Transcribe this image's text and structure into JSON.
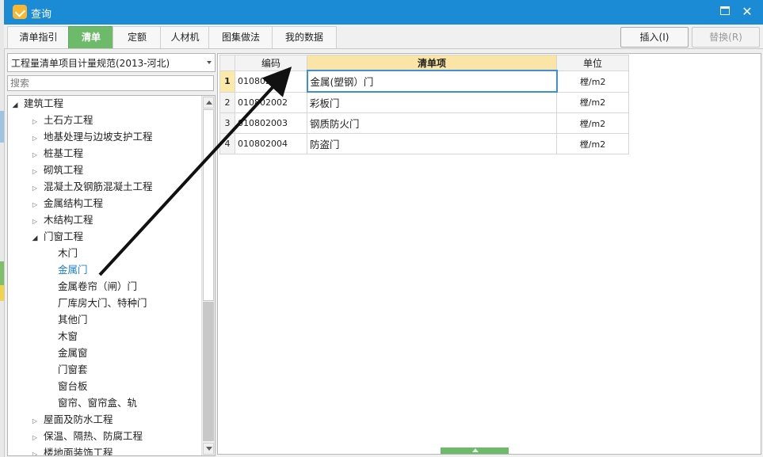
{
  "window": {
    "title": "查询",
    "close_glyph": "✕"
  },
  "tabs": [
    {
      "label": "清单指引",
      "active": false
    },
    {
      "label": "清单",
      "active": true
    },
    {
      "label": "定额",
      "active": false
    },
    {
      "label": "人材机",
      "active": false
    },
    {
      "label": "图集做法",
      "active": false
    },
    {
      "label": "我的数据",
      "active": false
    }
  ],
  "toolbar": {
    "insert_label": "插入(I)",
    "replace_label": "替换(R)"
  },
  "left": {
    "spec_select": "工程量清单项目计量规范(2013-河北)",
    "search_placeholder": "搜索",
    "tree": [
      {
        "label": "建筑工程",
        "level": 0,
        "state": "open"
      },
      {
        "label": "土石方工程",
        "level": 1,
        "state": "closed"
      },
      {
        "label": "地基处理与边坡支护工程",
        "level": 1,
        "state": "closed"
      },
      {
        "label": "桩基工程",
        "level": 1,
        "state": "closed"
      },
      {
        "label": "砌筑工程",
        "level": 1,
        "state": "closed"
      },
      {
        "label": "混凝土及钢筋混凝土工程",
        "level": 1,
        "state": "closed"
      },
      {
        "label": "金属结构工程",
        "level": 1,
        "state": "closed"
      },
      {
        "label": "木结构工程",
        "level": 1,
        "state": "closed"
      },
      {
        "label": "门窗工程",
        "level": 1,
        "state": "open"
      },
      {
        "label": "木门",
        "level": 2,
        "state": "leaf"
      },
      {
        "label": "金属门",
        "level": 2,
        "state": "leaf",
        "selected": true
      },
      {
        "label": "金属卷帘（闸）门",
        "level": 2,
        "state": "leaf"
      },
      {
        "label": "厂库房大门、特种门",
        "level": 2,
        "state": "leaf"
      },
      {
        "label": "其他门",
        "level": 2,
        "state": "leaf"
      },
      {
        "label": "木窗",
        "level": 2,
        "state": "leaf"
      },
      {
        "label": "金属窗",
        "level": 2,
        "state": "leaf"
      },
      {
        "label": "门窗套",
        "level": 2,
        "state": "leaf"
      },
      {
        "label": "窗台板",
        "level": 2,
        "state": "leaf"
      },
      {
        "label": "窗帘、窗帘盒、轨",
        "level": 2,
        "state": "leaf"
      },
      {
        "label": "屋面及防水工程",
        "level": 1,
        "state": "closed"
      },
      {
        "label": "保温、隔热、防腐工程",
        "level": 1,
        "state": "closed"
      },
      {
        "label": "楼地面装饰工程",
        "level": 1,
        "state": "closed"
      }
    ]
  },
  "grid": {
    "columns": [
      "",
      "编码",
      "清单项",
      "单位"
    ],
    "rows": [
      {
        "num": "1",
        "code": "010802001",
        "item": "金属(塑钢）门",
        "unit": "樘/m2"
      },
      {
        "num": "2",
        "code": "010802002",
        "item": "彩板门",
        "unit": "樘/m2"
      },
      {
        "num": "3",
        "code": "010802003",
        "item": "钢质防火门",
        "unit": "樘/m2"
      },
      {
        "num": "4",
        "code": "010802004",
        "item": "防盗门",
        "unit": "樘/m2"
      }
    ]
  },
  "colors": {
    "titlebar": "#1c8bd6",
    "active_tab": "#6dba6a",
    "selected_tree_text": "#1a7fd4",
    "header_highlight": "#fbe5a6"
  }
}
